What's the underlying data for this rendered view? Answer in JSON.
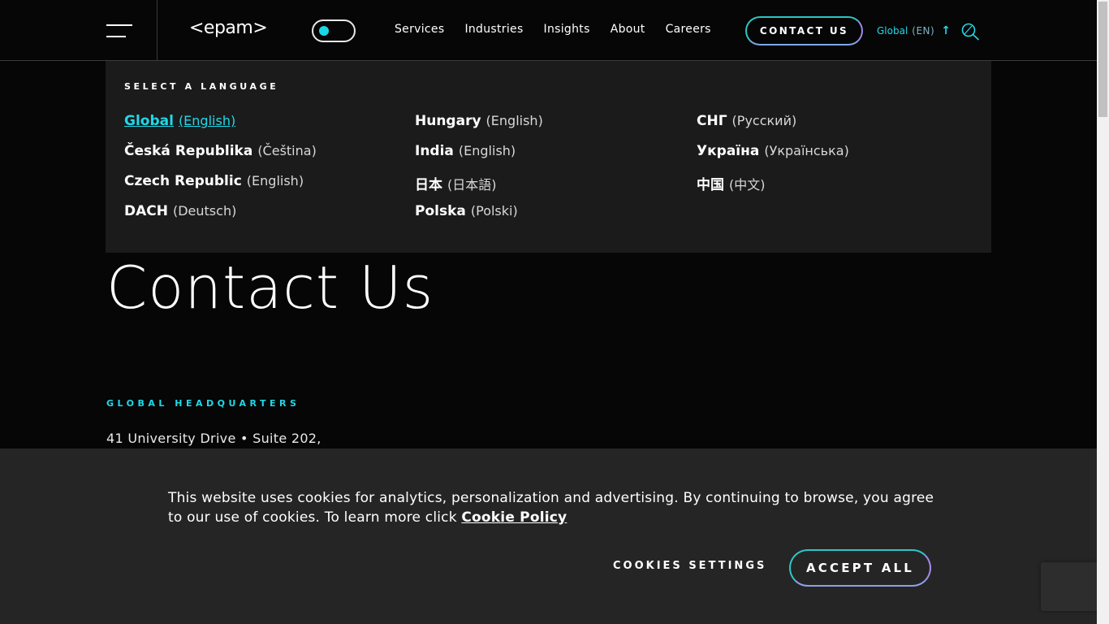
{
  "header": {
    "logo": "<epam>",
    "nav": [
      "Services",
      "Industries",
      "Insights",
      "About",
      "Careers"
    ],
    "contact_button": "CONTACT US",
    "language": {
      "label": "Global",
      "code": "(EN)"
    }
  },
  "language_panel": {
    "title": "SELECT A LANGUAGE",
    "columns": [
      [
        {
          "name": "Global",
          "sub": "(English)",
          "active": true
        },
        {
          "name": "Česká Republika",
          "sub": "(Čeština)"
        },
        {
          "name": "Czech Republic",
          "sub": "(English)"
        },
        {
          "name": "DACH",
          "sub": "(Deutsch)"
        }
      ],
      [
        {
          "name": "Hungary",
          "sub": "(English)"
        },
        {
          "name": "India",
          "sub": "(English)"
        },
        {
          "name": "日本",
          "sub": "(日本語)"
        },
        {
          "name": "Polska",
          "sub": "(Polski)"
        }
      ],
      [
        {
          "name": "СНГ",
          "sub": "(Русский)"
        },
        {
          "name": "Україна",
          "sub": "(Українська)"
        },
        {
          "name": "中国",
          "sub": "(中文)"
        }
      ]
    ]
  },
  "main": {
    "title": "Contact Us",
    "hq_label": "GLOBAL HEADQUARTERS",
    "hq_address": "41 University Drive • Suite 202,"
  },
  "cookie_banner": {
    "text": "This website uses cookies for analytics, personalization and advertising. By continuing to browse, you agree to our use of cookies. To learn more click ",
    "link": "Cookie Policy",
    "settings_label": "COOKIES SETTINGS",
    "accept_label": "ACCEPT ALL"
  },
  "colors": {
    "accent": "#20d8e8",
    "background": "#060606",
    "panel": "#1b1b1b",
    "cookie_bg": "#262626"
  }
}
